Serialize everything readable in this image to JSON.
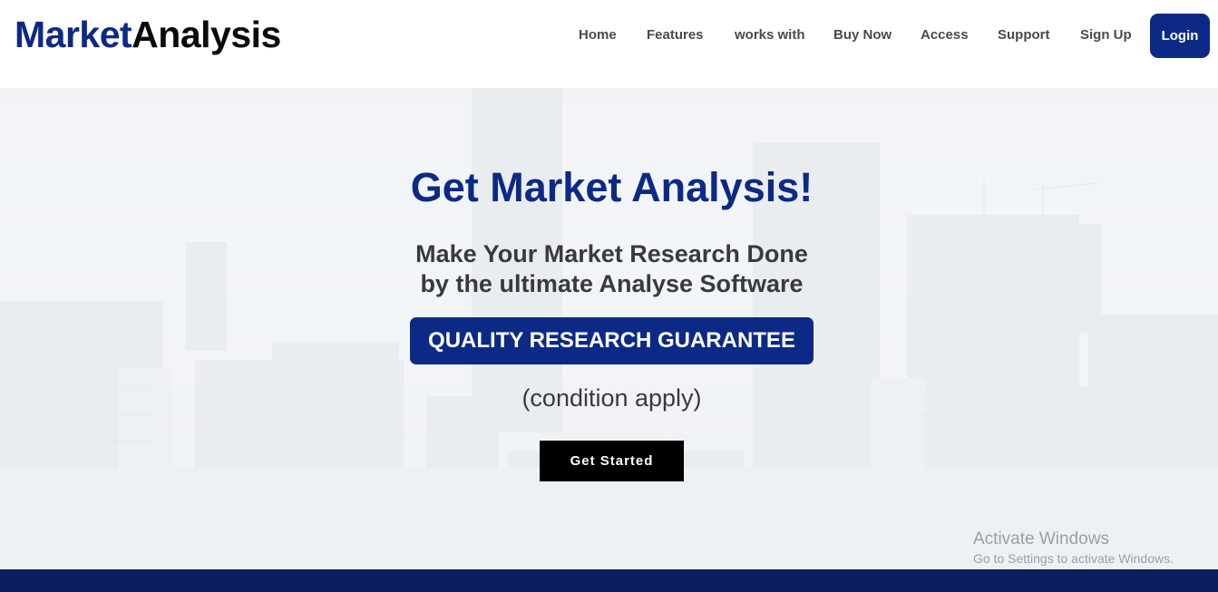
{
  "logo": {
    "part1": "Market",
    "part2": "Analysis"
  },
  "nav": {
    "items": [
      {
        "label": "Home"
      },
      {
        "label": "Features"
      },
      {
        "label": "works with"
      },
      {
        "label": "Buy Now"
      },
      {
        "label": "Access"
      },
      {
        "label": "Support"
      },
      {
        "label": "Sign Up"
      }
    ],
    "login_label": "Login"
  },
  "hero": {
    "headline": "Get Market Analysis!",
    "sub_line1": "Make Your Market Research Done",
    "sub_line2": "by the ultimate Analyse Software",
    "badge": "QUALITY RESEARCH GUARANTEE",
    "condition": "(condition apply)",
    "cta_label": "Get Started",
    "background": "city-skyline-image"
  },
  "watermark": {
    "line1": "Activate Windows",
    "line2": "Go to Settings to activate Windows."
  },
  "colors": {
    "brand_blue": "#0c2a85",
    "footer_navy": "#0b1f5e",
    "cta_black": "#000000",
    "nav_text": "#4a4a4a"
  }
}
